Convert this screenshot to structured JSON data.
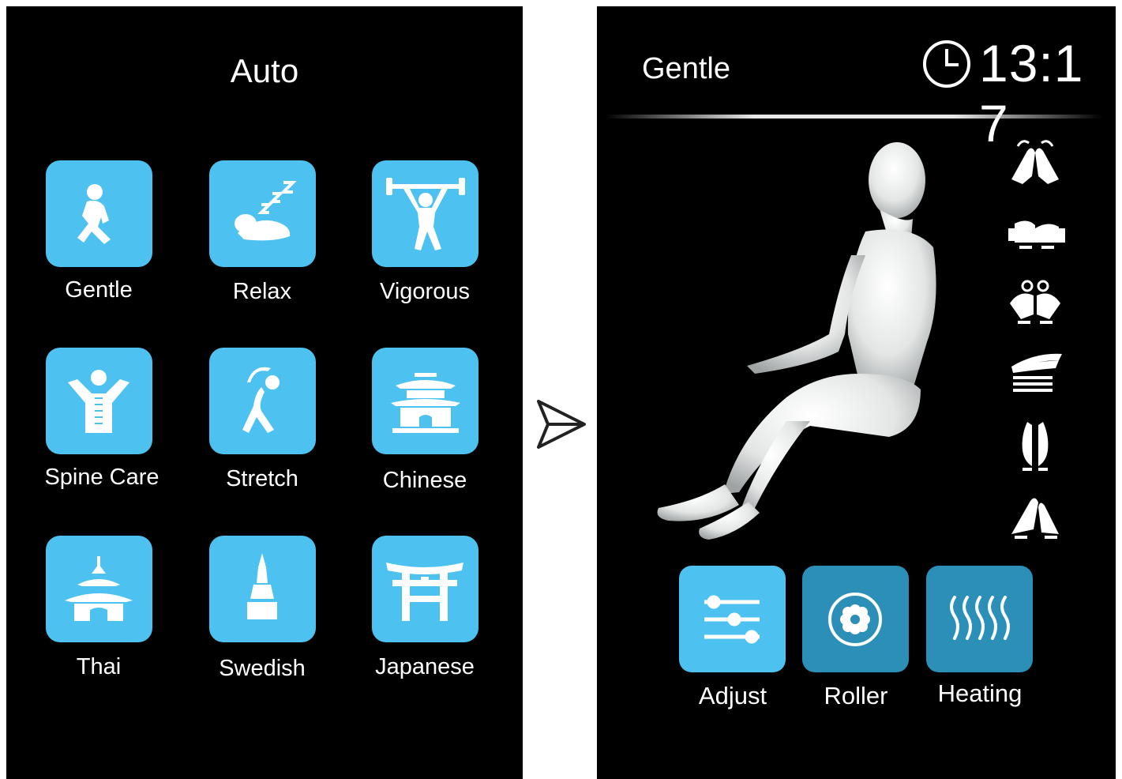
{
  "auto_screen": {
    "title": "Auto",
    "programs": [
      {
        "label": "Gentle",
        "icon": "gentle-person-icon"
      },
      {
        "label": "Relax",
        "icon": "sleeping-icon"
      },
      {
        "label": "Vigorous",
        "icon": "weightlifter-icon"
      },
      {
        "label": "Spine Care",
        "icon": "spine-icon"
      },
      {
        "label": "Stretch",
        "icon": "stretch-icon"
      },
      {
        "label": "Chinese",
        "icon": "chinese-temple-icon"
      },
      {
        "label": "Thai",
        "icon": "thai-temple-icon"
      },
      {
        "label": "Swedish",
        "icon": "swedish-tower-icon"
      },
      {
        "label": "Japanese",
        "icon": "torii-gate-icon"
      }
    ],
    "tile_color": "#4dc2f0"
  },
  "transition_icon": "arrow-right-icon",
  "running_screen": {
    "mode": "Gentle",
    "time": "13:1 7",
    "techniques": [
      "knead-icon",
      "tap-icon",
      "shiatsu-icon",
      "roll-icon",
      "clap-icon",
      "knock-icon"
    ],
    "controls": [
      {
        "label": "Adjust",
        "icon": "sliders-icon",
        "color": "#4dc2f0"
      },
      {
        "label": "Roller",
        "icon": "roller-icon",
        "color": "#2b8fb8"
      },
      {
        "label": "Heating",
        "icon": "heating-icon",
        "color": "#2b8fb8"
      }
    ]
  }
}
